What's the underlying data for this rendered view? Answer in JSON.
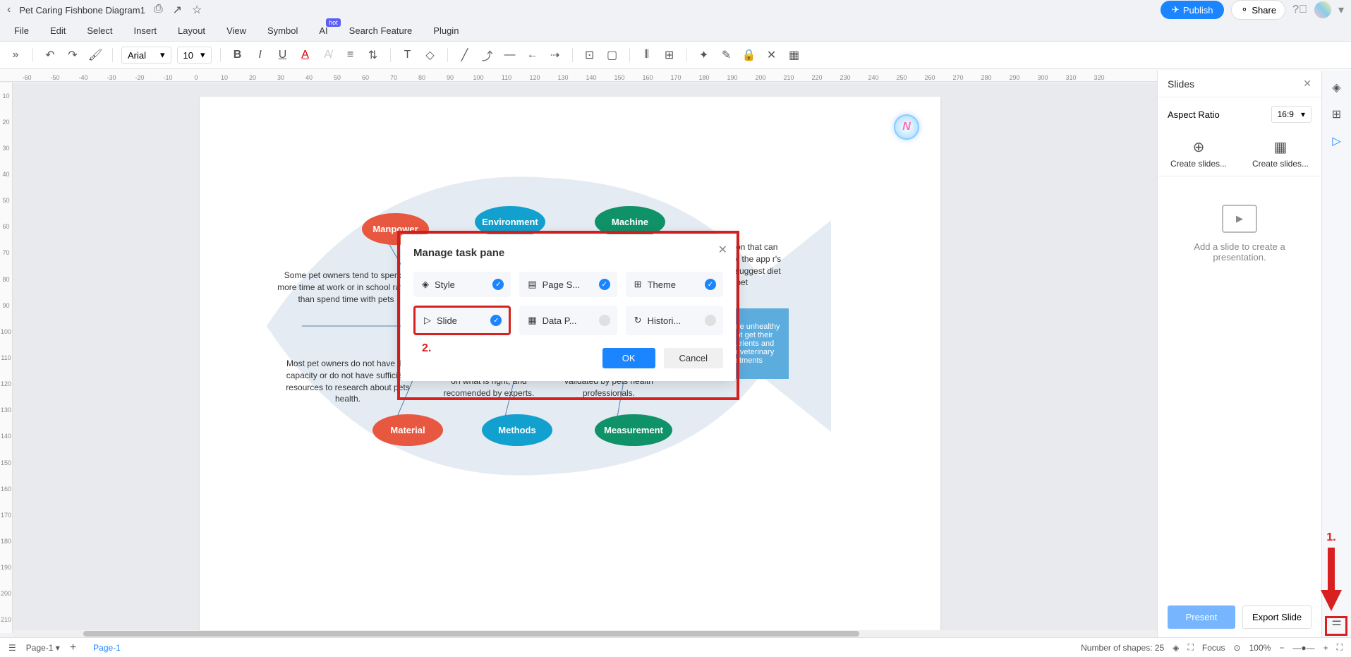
{
  "title_bar": {
    "doc_title": "Pet Caring Fishbone Diagram1",
    "publish": "Publish",
    "share": "Share"
  },
  "menu": {
    "file": "File",
    "edit": "Edit",
    "select": "Select",
    "insert": "Insert",
    "layout": "Layout",
    "view": "View",
    "symbol": "Symbol",
    "ai": "AI",
    "ai_badge": "hot",
    "search": "Search Feature",
    "plugin": "Plugin"
  },
  "toolbar": {
    "font": "Arial",
    "size": "10"
  },
  "ruler_h": [
    "-60",
    "-50",
    "-40",
    "-30",
    "-20",
    "-10",
    "0",
    "10",
    "20",
    "30",
    "40",
    "50",
    "60",
    "70",
    "80",
    "90",
    "100",
    "110",
    "120",
    "130",
    "140",
    "150",
    "160",
    "170",
    "180",
    "190",
    "200",
    "210",
    "220",
    "230",
    "240",
    "250",
    "260",
    "270",
    "280",
    "290",
    "300",
    "310",
    "320"
  ],
  "ruler_v": [
    "10",
    "20",
    "30",
    "40",
    "50",
    "60",
    "70",
    "80",
    "90",
    "100",
    "110",
    "120",
    "130",
    "140",
    "150",
    "160",
    "170",
    "180",
    "190",
    "200",
    "210"
  ],
  "diagram": {
    "manpower": "Manpower",
    "environment": "Environment",
    "machine": "Machine",
    "material": "Material",
    "methods": "Methods",
    "measurement": "Measurement",
    "text1": "Some pet owners tend to spends more time at work or in school rather than spend time with pets",
    "text2": "Most pet owners do not have the capacity or do not have sufficient resources to research about pets health.",
    "text3": "on what is right, and recomended by experts.",
    "text4": "validated by pets health professionals.",
    "text5": "ack of application that can rack and monitor the app r's pet health, and suggest diet for the pet",
    "result": "Pets become unhealthy and do not get their proper nutrients and miss their veterinary appointments"
  },
  "dialog": {
    "title": "Manage task pane",
    "style": "Style",
    "page_s": "Page S...",
    "theme": "Theme",
    "slide": "Slide",
    "data_p": "Data P...",
    "histori": "Histori...",
    "ok": "OK",
    "cancel": "Cancel",
    "annotation": "2."
  },
  "right_panel": {
    "title": "Slides",
    "aspect_ratio": "Aspect Ratio",
    "aspect_value": "16:9",
    "create1": "Create slides...",
    "create2": "Create slides...",
    "placeholder": "Add a slide to create a presentation.",
    "present": "Present",
    "export": "Export Slide"
  },
  "arrow": {
    "label": "1."
  },
  "bottom": {
    "page_select": "Page-1",
    "page_tab": "Page-1",
    "shapes": "Number of shapes: 25",
    "focus": "Focus",
    "zoom": "100%"
  }
}
